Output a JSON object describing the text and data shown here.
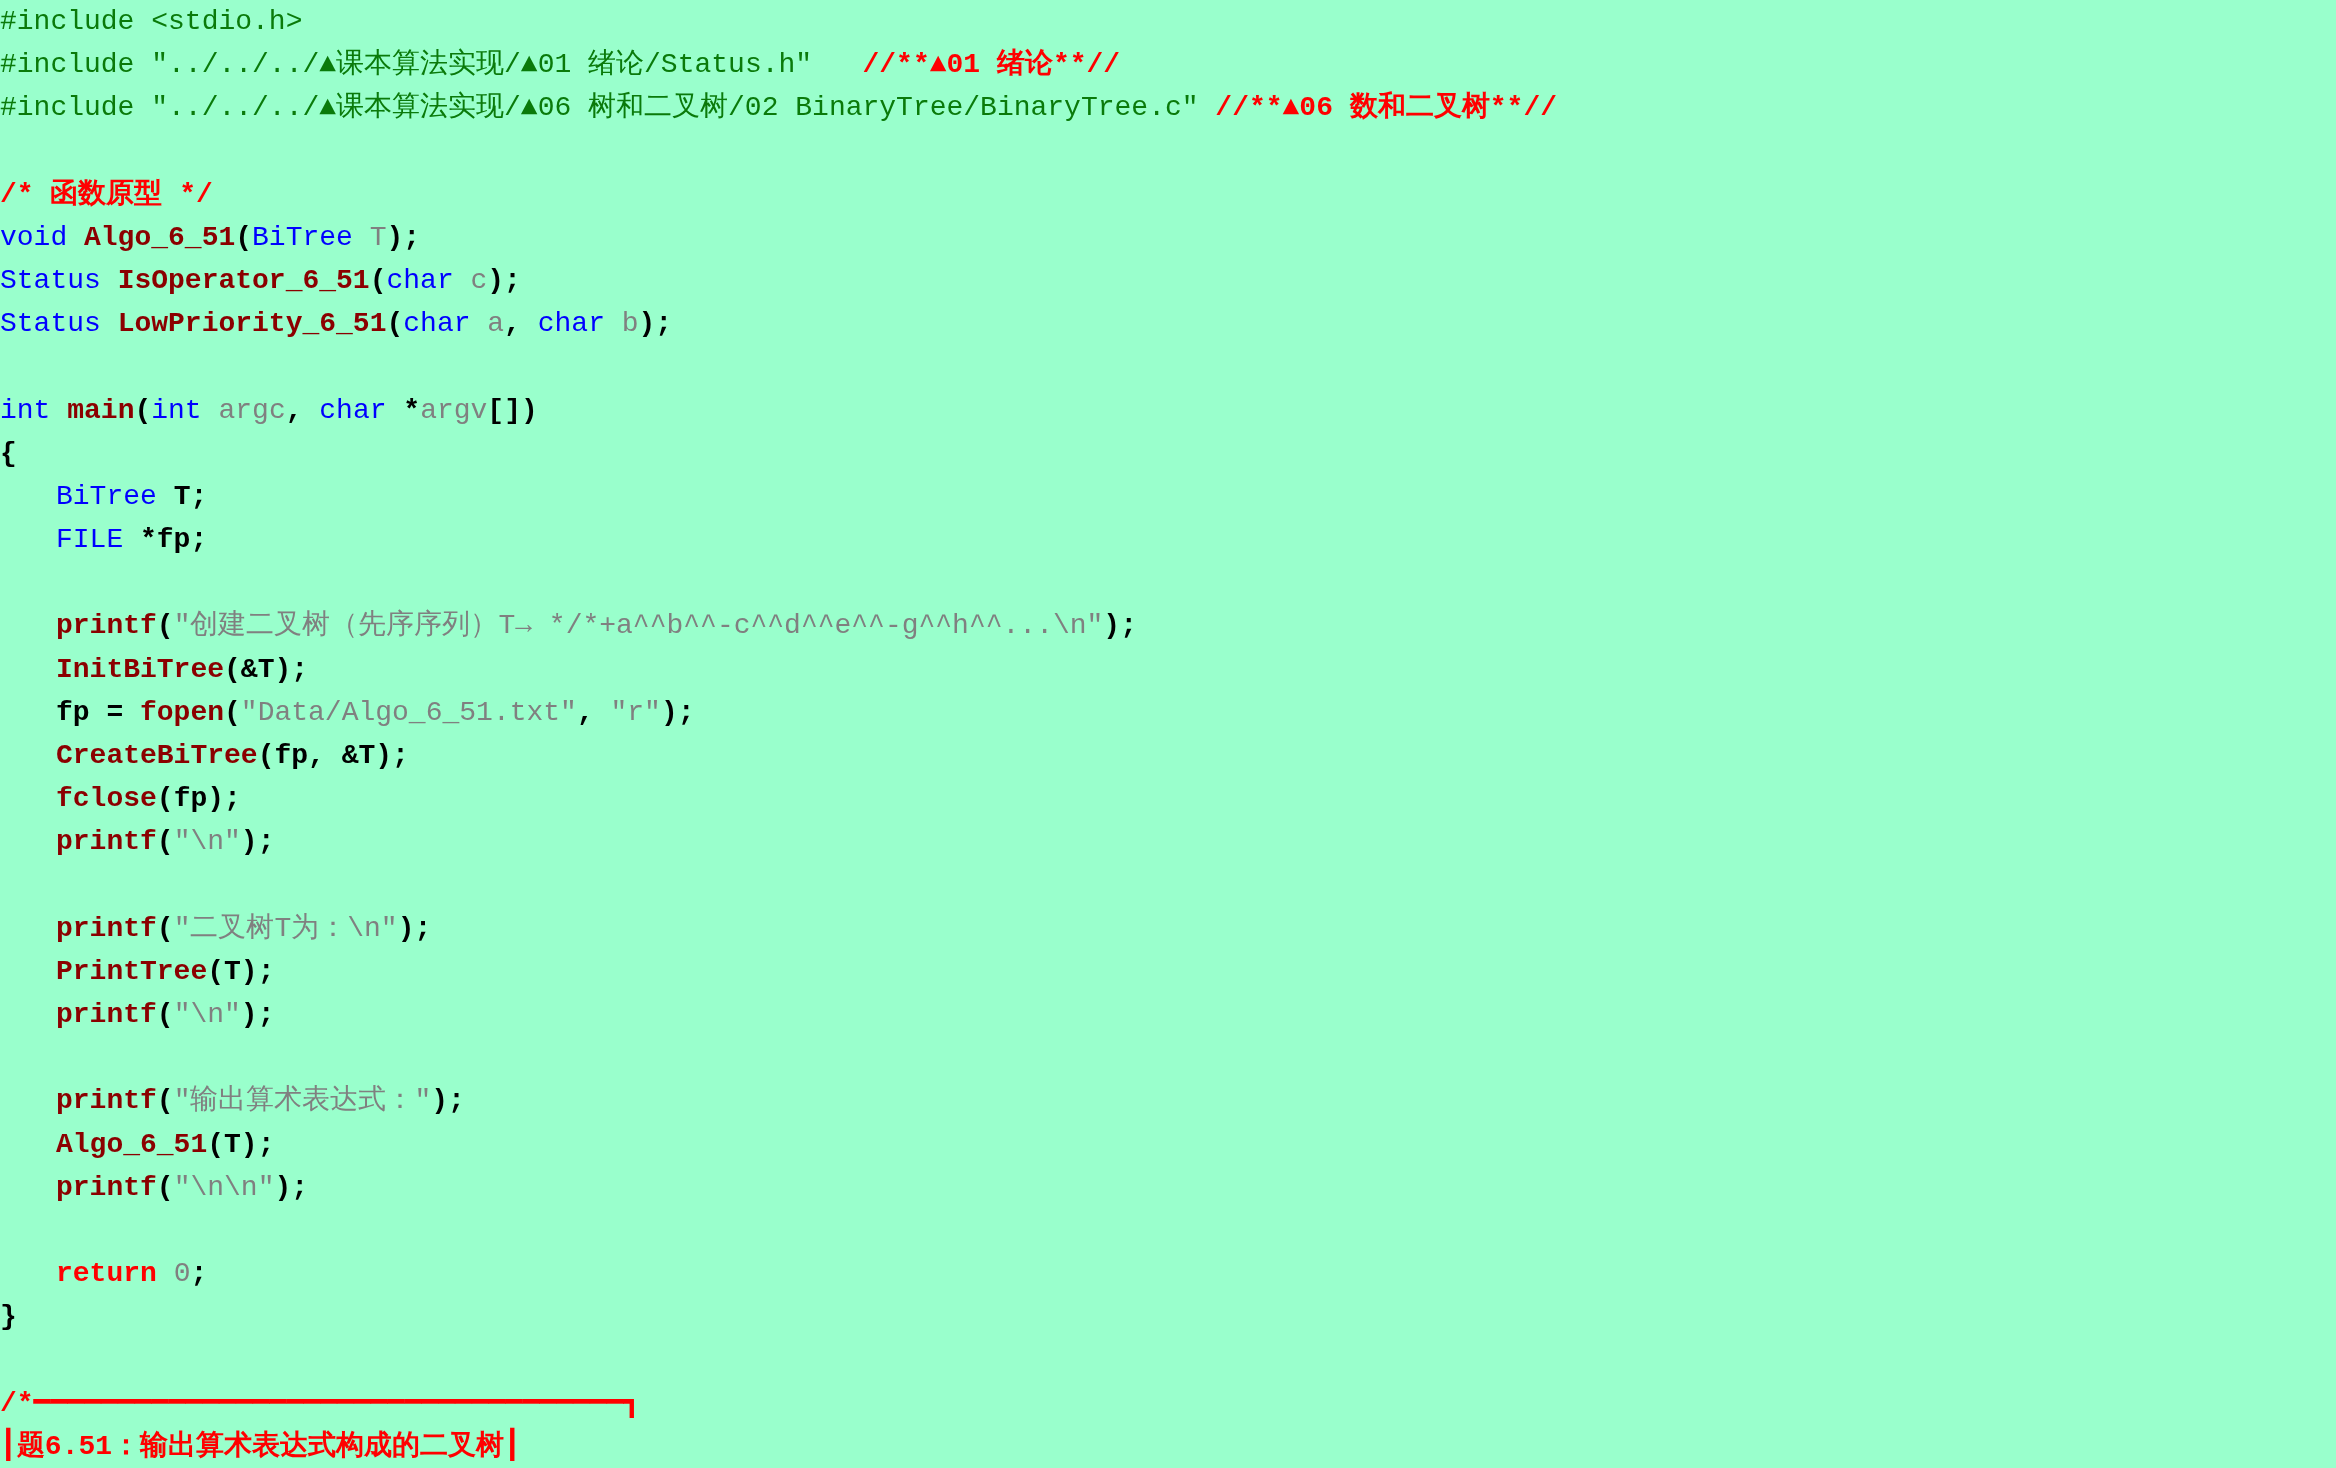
{
  "lines": [
    {
      "kind": "code",
      "indented": false,
      "tokens": [
        {
          "kind": "preproc",
          "text": "#include <stdio.h>"
        }
      ]
    },
    {
      "kind": "code",
      "indented": false,
      "tokens": [
        {
          "kind": "preproc",
          "text": "#include \"../../../▲课本算法实现/▲01 绪论/Status.h\"   "
        },
        {
          "kind": "comment",
          "text": "//**▲01 绪论**//"
        }
      ]
    },
    {
      "kind": "code",
      "indented": false,
      "tokens": [
        {
          "kind": "preproc",
          "text": "#include \"../../../▲课本算法实现/▲06 树和二叉树/02 BinaryTree/BinaryTree.c\" "
        },
        {
          "kind": "comment",
          "text": "//**▲06 数和二叉树**//"
        }
      ]
    },
    {
      "kind": "blank"
    },
    {
      "kind": "code",
      "indented": false,
      "tokens": [
        {
          "kind": "comment",
          "text": "/* 函数原型 */"
        }
      ]
    },
    {
      "kind": "code",
      "indented": false,
      "tokens": [
        {
          "kind": "keyword",
          "text": "void "
        },
        {
          "kind": "function",
          "text": "Algo_6_51"
        },
        {
          "kind": "plain",
          "text": "("
        },
        {
          "kind": "keyword",
          "text": "BiTree "
        },
        {
          "kind": "param",
          "text": "T"
        },
        {
          "kind": "plain",
          "text": ");"
        }
      ]
    },
    {
      "kind": "code",
      "indented": false,
      "tokens": [
        {
          "kind": "keyword",
          "text": "Status "
        },
        {
          "kind": "function",
          "text": "IsOperator_6_51"
        },
        {
          "kind": "plain",
          "text": "("
        },
        {
          "kind": "keyword",
          "text": "char "
        },
        {
          "kind": "param",
          "text": "c"
        },
        {
          "kind": "plain",
          "text": ");"
        }
      ]
    },
    {
      "kind": "code",
      "indented": false,
      "tokens": [
        {
          "kind": "keyword",
          "text": "Status "
        },
        {
          "kind": "function",
          "text": "LowPriority_6_51"
        },
        {
          "kind": "plain",
          "text": "("
        },
        {
          "kind": "keyword",
          "text": "char "
        },
        {
          "kind": "param",
          "text": "a"
        },
        {
          "kind": "plain",
          "text": ", "
        },
        {
          "kind": "keyword",
          "text": "char "
        },
        {
          "kind": "param",
          "text": "b"
        },
        {
          "kind": "plain",
          "text": ");"
        }
      ]
    },
    {
      "kind": "blank"
    },
    {
      "kind": "code",
      "indented": false,
      "tokens": [
        {
          "kind": "keyword",
          "text": "int "
        },
        {
          "kind": "function",
          "text": "main"
        },
        {
          "kind": "plain",
          "text": "("
        },
        {
          "kind": "keyword",
          "text": "int "
        },
        {
          "kind": "param",
          "text": "argc"
        },
        {
          "kind": "plain",
          "text": ", "
        },
        {
          "kind": "keyword",
          "text": "char "
        },
        {
          "kind": "plain",
          "text": "*"
        },
        {
          "kind": "param",
          "text": "argv"
        },
        {
          "kind": "plain",
          "text": "[])"
        }
      ]
    },
    {
      "kind": "code",
      "indented": false,
      "tokens": [
        {
          "kind": "plain",
          "text": "{"
        }
      ]
    },
    {
      "kind": "code",
      "indented": true,
      "tokens": [
        {
          "kind": "keyword",
          "text": "BiTree "
        },
        {
          "kind": "plain",
          "text": "T;"
        }
      ]
    },
    {
      "kind": "code",
      "indented": true,
      "tokens": [
        {
          "kind": "keyword",
          "text": "FILE "
        },
        {
          "kind": "plain",
          "text": "*fp;"
        }
      ]
    },
    {
      "kind": "blank"
    },
    {
      "kind": "code",
      "indented": true,
      "tokens": [
        {
          "kind": "function",
          "text": "printf"
        },
        {
          "kind": "plain",
          "text": "("
        },
        {
          "kind": "string",
          "text": "\"创建二叉树（先序序列）T→ */*+a^^b^^-c^^d^^e^^-g^^h^^...\\n\""
        },
        {
          "kind": "plain",
          "text": ");"
        }
      ]
    },
    {
      "kind": "code",
      "indented": true,
      "tokens": [
        {
          "kind": "function",
          "text": "InitBiTree"
        },
        {
          "kind": "plain",
          "text": "(&T);"
        }
      ]
    },
    {
      "kind": "code",
      "indented": true,
      "tokens": [
        {
          "kind": "plain",
          "text": "fp = "
        },
        {
          "kind": "function",
          "text": "fopen"
        },
        {
          "kind": "plain",
          "text": "("
        },
        {
          "kind": "string",
          "text": "\"Data/Algo_6_51.txt\""
        },
        {
          "kind": "plain",
          "text": ", "
        },
        {
          "kind": "string",
          "text": "\"r\""
        },
        {
          "kind": "plain",
          "text": ");"
        }
      ]
    },
    {
      "kind": "code",
      "indented": true,
      "tokens": [
        {
          "kind": "function",
          "text": "CreateBiTree"
        },
        {
          "kind": "plain",
          "text": "(fp, &T);"
        }
      ]
    },
    {
      "kind": "code",
      "indented": true,
      "tokens": [
        {
          "kind": "function",
          "text": "fclose"
        },
        {
          "kind": "plain",
          "text": "(fp);"
        }
      ]
    },
    {
      "kind": "code",
      "indented": true,
      "tokens": [
        {
          "kind": "function",
          "text": "printf"
        },
        {
          "kind": "plain",
          "text": "("
        },
        {
          "kind": "string",
          "text": "\"\\n\""
        },
        {
          "kind": "plain",
          "text": ");"
        }
      ]
    },
    {
      "kind": "blank"
    },
    {
      "kind": "code",
      "indented": true,
      "tokens": [
        {
          "kind": "function",
          "text": "printf"
        },
        {
          "kind": "plain",
          "text": "("
        },
        {
          "kind": "string",
          "text": "\"二叉树T为：\\n\""
        },
        {
          "kind": "plain",
          "text": ");"
        }
      ]
    },
    {
      "kind": "code",
      "indented": true,
      "tokens": [
        {
          "kind": "function",
          "text": "PrintTree"
        },
        {
          "kind": "plain",
          "text": "(T);"
        }
      ]
    },
    {
      "kind": "code",
      "indented": true,
      "tokens": [
        {
          "kind": "function",
          "text": "printf"
        },
        {
          "kind": "plain",
          "text": "("
        },
        {
          "kind": "string",
          "text": "\"\\n\""
        },
        {
          "kind": "plain",
          "text": ");"
        }
      ]
    },
    {
      "kind": "blank"
    },
    {
      "kind": "code",
      "indented": true,
      "tokens": [
        {
          "kind": "function",
          "text": "printf"
        },
        {
          "kind": "plain",
          "text": "("
        },
        {
          "kind": "string",
          "text": "\"输出算术表达式：\""
        },
        {
          "kind": "plain",
          "text": ");"
        }
      ]
    },
    {
      "kind": "code",
      "indented": true,
      "tokens": [
        {
          "kind": "function",
          "text": "Algo_6_51"
        },
        {
          "kind": "plain",
          "text": "(T);"
        }
      ]
    },
    {
      "kind": "code",
      "indented": true,
      "tokens": [
        {
          "kind": "function",
          "text": "printf"
        },
        {
          "kind": "plain",
          "text": "("
        },
        {
          "kind": "string",
          "text": "\"\\n\\n\""
        },
        {
          "kind": "plain",
          "text": ");"
        }
      ]
    },
    {
      "kind": "blank"
    },
    {
      "kind": "code",
      "indented": true,
      "tokens": [
        {
          "kind": "control",
          "text": "return "
        },
        {
          "kind": "number",
          "text": "0"
        },
        {
          "kind": "plain",
          "text": ";"
        }
      ]
    },
    {
      "kind": "code",
      "indented": false,
      "tokens": [
        {
          "kind": "plain",
          "text": "}"
        }
      ]
    },
    {
      "kind": "blank"
    },
    {
      "kind": "code",
      "indented": false,
      "tokens": [
        {
          "kind": "comment",
          "text": "/*━━━━━━━━━━━━━━━━━━━━━━━━━━━━━━━━━━━┓"
        }
      ]
    },
    {
      "kind": "code",
      "indented": false,
      "tokens": [
        {
          "kind": "comment",
          "text": "┃题6.51：输出算术表达式构成的二叉树┃"
        }
      ]
    }
  ]
}
